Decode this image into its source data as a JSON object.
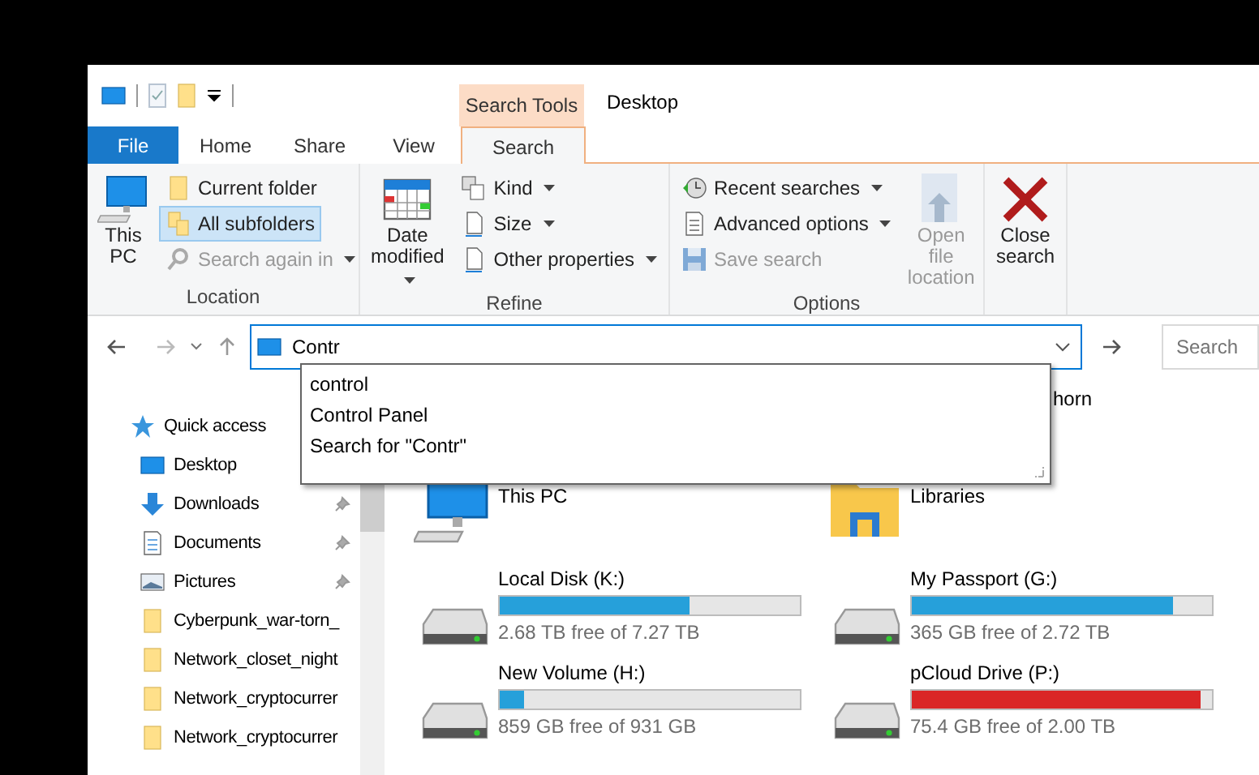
{
  "context_tab": {
    "label": "Search Tools"
  },
  "window": {
    "title": "Desktop"
  },
  "ribbon_tabs": [
    {
      "label": "File",
      "kind": "file",
      "selected": false
    },
    {
      "label": "Home",
      "kind": "tab",
      "selected": false
    },
    {
      "label": "Share",
      "kind": "tab",
      "selected": false
    },
    {
      "label": "View",
      "kind": "tab",
      "selected": false
    },
    {
      "label": "Search",
      "kind": "tab",
      "selected": true
    }
  ],
  "ribbon_groups": [
    {
      "label": "Location",
      "items": [
        {
          "kind": "large",
          "label": "This PC",
          "disabled": false,
          "dropdown": false
        },
        {
          "kind": "stack",
          "buttons": [
            {
              "label": "Current folder",
              "disabled": false,
              "selected": false,
              "dropdown": false
            },
            {
              "label": "All subfolders",
              "disabled": false,
              "selected": true,
              "dropdown": false
            },
            {
              "label": "Search again in",
              "disabled": true,
              "selected": false,
              "dropdown": true
            }
          ]
        }
      ]
    },
    {
      "label": "Refine",
      "items": [
        {
          "kind": "large",
          "label": "Date modified",
          "disabled": false,
          "dropdown": true
        },
        {
          "kind": "stack",
          "buttons": [
            {
              "label": "Kind",
              "disabled": false,
              "selected": false,
              "dropdown": true
            },
            {
              "label": "Size",
              "disabled": false,
              "selected": false,
              "dropdown": true
            },
            {
              "label": "Other properties",
              "disabled": false,
              "selected": false,
              "dropdown": true
            }
          ]
        }
      ]
    },
    {
      "label": "Options",
      "items": [
        {
          "kind": "stack",
          "buttons": [
            {
              "label": "Recent searches",
              "disabled": false,
              "selected": false,
              "dropdown": true
            },
            {
              "label": "Advanced options",
              "disabled": false,
              "selected": false,
              "dropdown": true
            },
            {
              "label": "Save search",
              "disabled": true,
              "selected": false,
              "dropdown": false
            }
          ]
        },
        {
          "kind": "large",
          "label": "Open file location",
          "disabled": true,
          "dropdown": false
        }
      ]
    },
    {
      "items": [
        {
          "kind": "large",
          "label": "Close search",
          "disabled": false,
          "dropdown": false
        }
      ]
    }
  ],
  "address_bar": {
    "value": "Contr",
    "focused": true
  },
  "search_box": {
    "placeholder": "Search"
  },
  "autocomplete": [
    "control",
    "Control Panel",
    "Search for \"Contr\""
  ],
  "sidebar": [
    {
      "label": "Quick access",
      "children": [
        {
          "label": "Desktop",
          "kind": "desktop"
        },
        {
          "label": "Downloads",
          "kind": "downloads",
          "pinned": true
        },
        {
          "label": "Documents",
          "kind": "documents",
          "pinned": true
        },
        {
          "label": "Pictures",
          "kind": "pictures",
          "pinned": true
        },
        {
          "label": "Cyberpunk_war-torn_",
          "kind": "folder",
          "pinned": false
        },
        {
          "label": "Network_closet_night",
          "kind": "folder",
          "pinned": false
        },
        {
          "label": "Network_cryptocurrer",
          "kind": "folder",
          "pinned": false
        },
        {
          "label": "Network_cryptocurrer",
          "kind": "folder",
          "pinned": false
        }
      ]
    }
  ],
  "content": {
    "partial_text": "horn",
    "items": [
      {
        "name": "This PC",
        "kind": "computer"
      },
      {
        "name": "Libraries",
        "kind": "libraries"
      },
      {
        "name": "Local Disk (K:)",
        "kind": "drive",
        "level": 0.63,
        "color": "#26a0da",
        "reading": "2.68 TB free of 7.27 TB"
      },
      {
        "name": "My Passport (G:)",
        "kind": "drive",
        "level": 0.87,
        "color": "#26a0da",
        "reading": "365 GB free of 2.72 TB"
      },
      {
        "name": "New Volume (H:)",
        "kind": "drive",
        "level": 0.08,
        "color": "#26a0da",
        "reading": "859 GB free of 931 GB"
      },
      {
        "name": "pCloud Drive (P:)",
        "kind": "drive",
        "level": 0.96,
        "color": "#da2626",
        "reading": "75.4 GB free of 2.00 TB"
      }
    ]
  }
}
